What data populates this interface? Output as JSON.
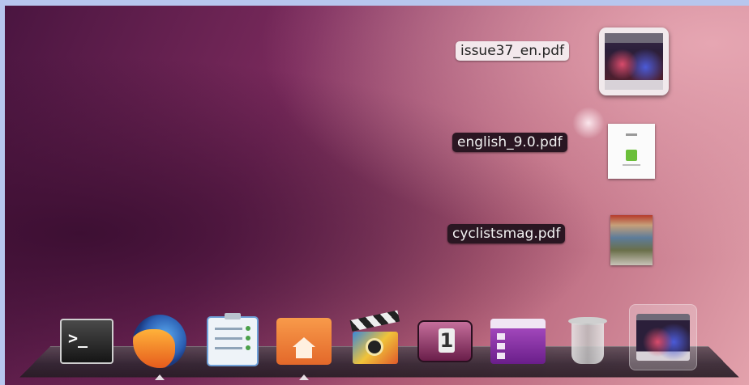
{
  "desktop": {
    "stacks": [
      {
        "label": "issue37_en.pdf",
        "thumb_icon": "pdf-thumbnail-icon"
      },
      {
        "label": "english_9.0.pdf",
        "thumb_icon": "pdf-thumbnail-icon"
      },
      {
        "label": "cyclistsmag.pdf",
        "thumb_icon": "pdf-thumbnail-icon"
      }
    ]
  },
  "dock": {
    "items": [
      {
        "name": "terminal",
        "icon": "terminal-icon",
        "glyph": ">_",
        "running": false
      },
      {
        "name": "firefox",
        "icon": "firefox-icon",
        "running": true
      },
      {
        "name": "tasks",
        "icon": "notes-checklist-icon",
        "running": false
      },
      {
        "name": "home-folder",
        "icon": "home-folder-icon",
        "running": true
      },
      {
        "name": "media-player",
        "icon": "clapperboard-icon",
        "running": false
      },
      {
        "name": "workspace-switcher",
        "icon": "workspace-icon",
        "glyph": "1",
        "running": false
      },
      {
        "name": "panel-app",
        "icon": "panel-icon",
        "running": false
      },
      {
        "name": "trash",
        "icon": "trash-icon",
        "running": false
      },
      {
        "name": "pdf-stack",
        "icon": "pdf-thumbnail-icon",
        "running": false,
        "active": true
      }
    ]
  },
  "colors": {
    "desktop_dark": "#4a1540",
    "desktop_light": "#e3a2ac",
    "label_dark_bg": "#2a1622",
    "label_light_bg": "#f3e8ec",
    "frame": "#b7c6ee"
  }
}
